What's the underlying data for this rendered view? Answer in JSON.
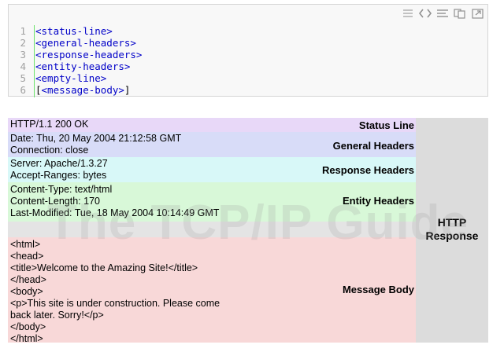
{
  "code_block": {
    "toolbar": {
      "icons": [
        "menu-icon",
        "view-source-icon",
        "wrap-icon",
        "copy-icon",
        "popup-icon"
      ]
    },
    "lines": [
      {
        "number": "1",
        "text": "<status-line>"
      },
      {
        "number": "2",
        "text": "<general-headers>"
      },
      {
        "number": "3",
        "text": "<response-headers>"
      },
      {
        "number": "4",
        "text": "<entity-headers>"
      },
      {
        "number": "5",
        "text": "<empty-line>"
      },
      {
        "number": "6",
        "open": "[",
        "text": "<message-body>",
        "close": "]"
      }
    ]
  },
  "diagram": {
    "status": {
      "text": "HTTP/1.1 200 OK",
      "label": "Status Line",
      "color": "#e8d8f8"
    },
    "general": {
      "text": "Date: Thu, 20 May 2004 21:12:58 GMT\nConnection: close",
      "label": "General Headers",
      "color": "#d8dcf8"
    },
    "response": {
      "text": "Server: Apache/1.3.27\nAccept-Ranges: bytes",
      "label": "Response Headers",
      "color": "#d8f8f8"
    },
    "entity": {
      "text": "Content-Type: text/html\nContent-Length: 170\nLast-Modified: Tue, 18 May 2004 10:14:49 GMT",
      "label": "Entity Headers",
      "color": "#d8f8d8"
    },
    "body": {
      "text": "<html>\n<head>\n<title>Welcome to the Amazing Site!</title>\n</head>\n<body>\n<p>This site is under construction. Please come\nback later. Sorry!</p>\n</body>\n</html>",
      "label": "Message Body",
      "color": "#f8d8d8"
    },
    "side_label": "HTTP\nResponse",
    "watermark": "The TCP/IP Guide"
  }
}
